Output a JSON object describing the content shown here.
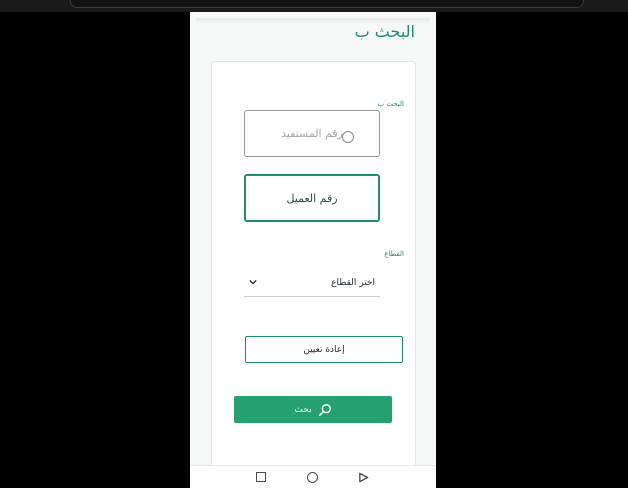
{
  "header": {
    "title": "البحث ب"
  },
  "form": {
    "search_by_label": "البحث ب",
    "options": [
      {
        "label": "رقم المستفيد",
        "state": "unselected"
      },
      {
        "label": "رقم العميل",
        "state": "selected"
      }
    ],
    "sector_label": "القطاع",
    "sector_select": {
      "selected_value": "اختر القطاع"
    },
    "reset_button_label": "إعادة تعيين",
    "search_button_label": "بحث"
  },
  "icons": {
    "search": "search-icon",
    "chevron": "chevron-down-icon",
    "nav_recents": "square-icon",
    "nav_home": "circle-icon",
    "nav_back": "triangle-icon"
  },
  "colors": {
    "accent": "#1f8f64",
    "button_fill": "#25a06f"
  }
}
